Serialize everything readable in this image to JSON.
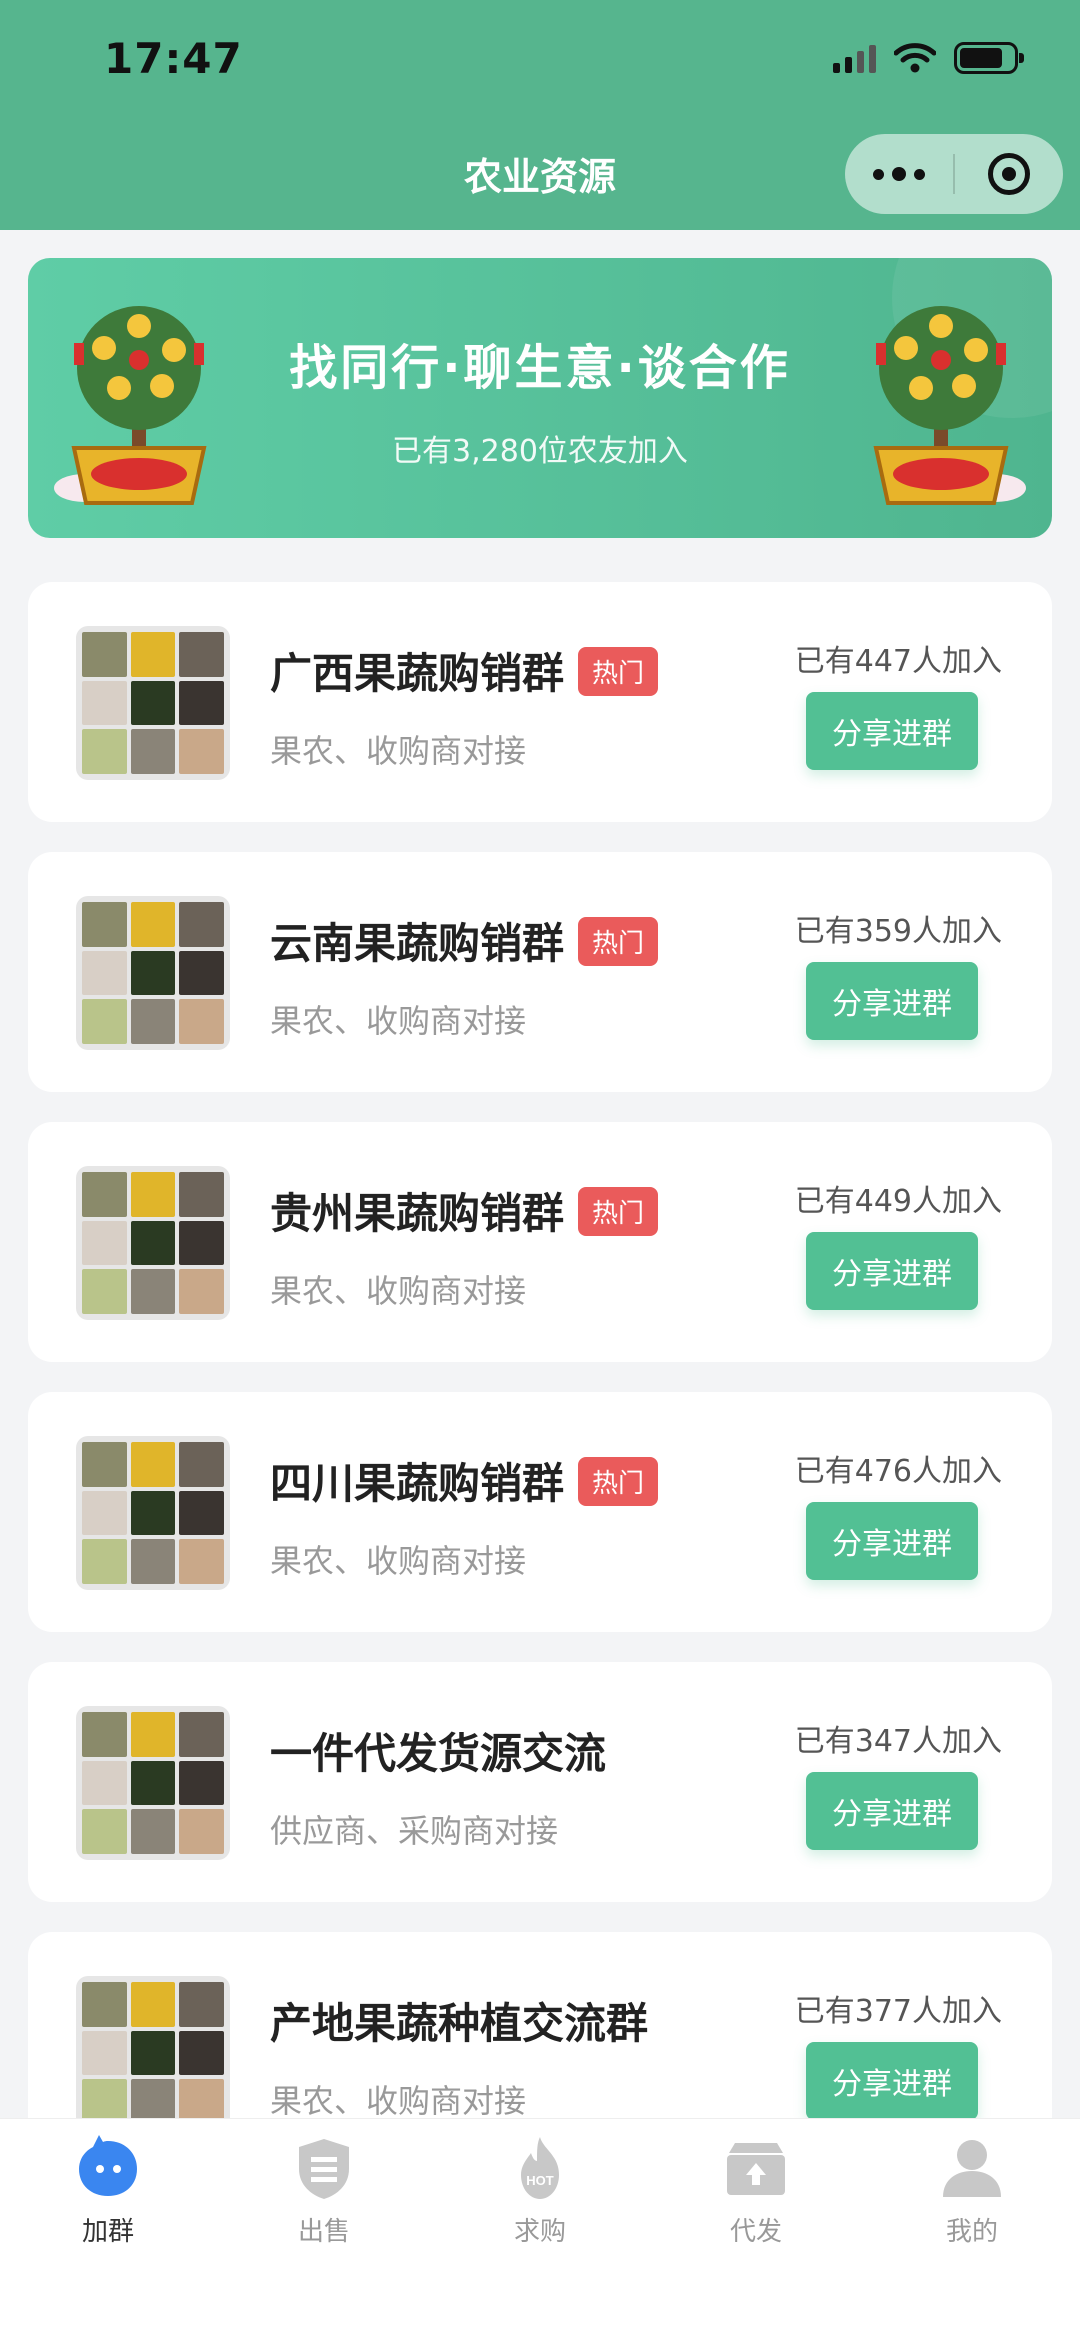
{
  "status_bar": {
    "time": "17:47"
  },
  "nav": {
    "title": "农业资源",
    "more_icon": "more-dots-icon",
    "close_icon": "target-icon"
  },
  "banner": {
    "title": "找同行·聊生意·谈合作",
    "subtitle": "已有3,280位农友加入",
    "decoration": "money-tree-icon"
  },
  "groups": [
    {
      "title": "广西果蔬购销群",
      "badge": "热门",
      "subtitle": "果农、收购商对接",
      "count": "已有447人加入",
      "button": "分享进群"
    },
    {
      "title": "云南果蔬购销群",
      "badge": "热门",
      "subtitle": "果农、收购商对接",
      "count": "已有359人加入",
      "button": "分享进群"
    },
    {
      "title": "贵州果蔬购销群",
      "badge": "热门",
      "subtitle": "果农、收购商对接",
      "count": "已有449人加入",
      "button": "分享进群"
    },
    {
      "title": "四川果蔬购销群",
      "badge": "热门",
      "subtitle": "果农、收购商对接",
      "count": "已有476人加入",
      "button": "分享进群"
    },
    {
      "title": "一件代发货源交流",
      "subtitle": "供应商、采购商对接",
      "count": "已有347人加入",
      "button": "分享进群"
    },
    {
      "title": "产地果蔬种植交流群",
      "subtitle": "果农、收购商对接",
      "count": "已有377人加入",
      "button": "分享进群"
    }
  ],
  "tabbar": [
    {
      "label": "加群",
      "icon": "chat-bubble-icon",
      "active": true
    },
    {
      "label": "出售",
      "icon": "sell-shield-icon",
      "active": false
    },
    {
      "label": "求购",
      "icon": "hot-flame-icon",
      "active": false
    },
    {
      "label": "代发",
      "icon": "upload-box-icon",
      "active": false
    },
    {
      "label": "我的",
      "icon": "user-icon",
      "active": false
    }
  ],
  "colors": {
    "brand": "#56b58e",
    "button": "#52c094",
    "hot": "#ea5b5b",
    "active_tab": "#3a86f0"
  }
}
